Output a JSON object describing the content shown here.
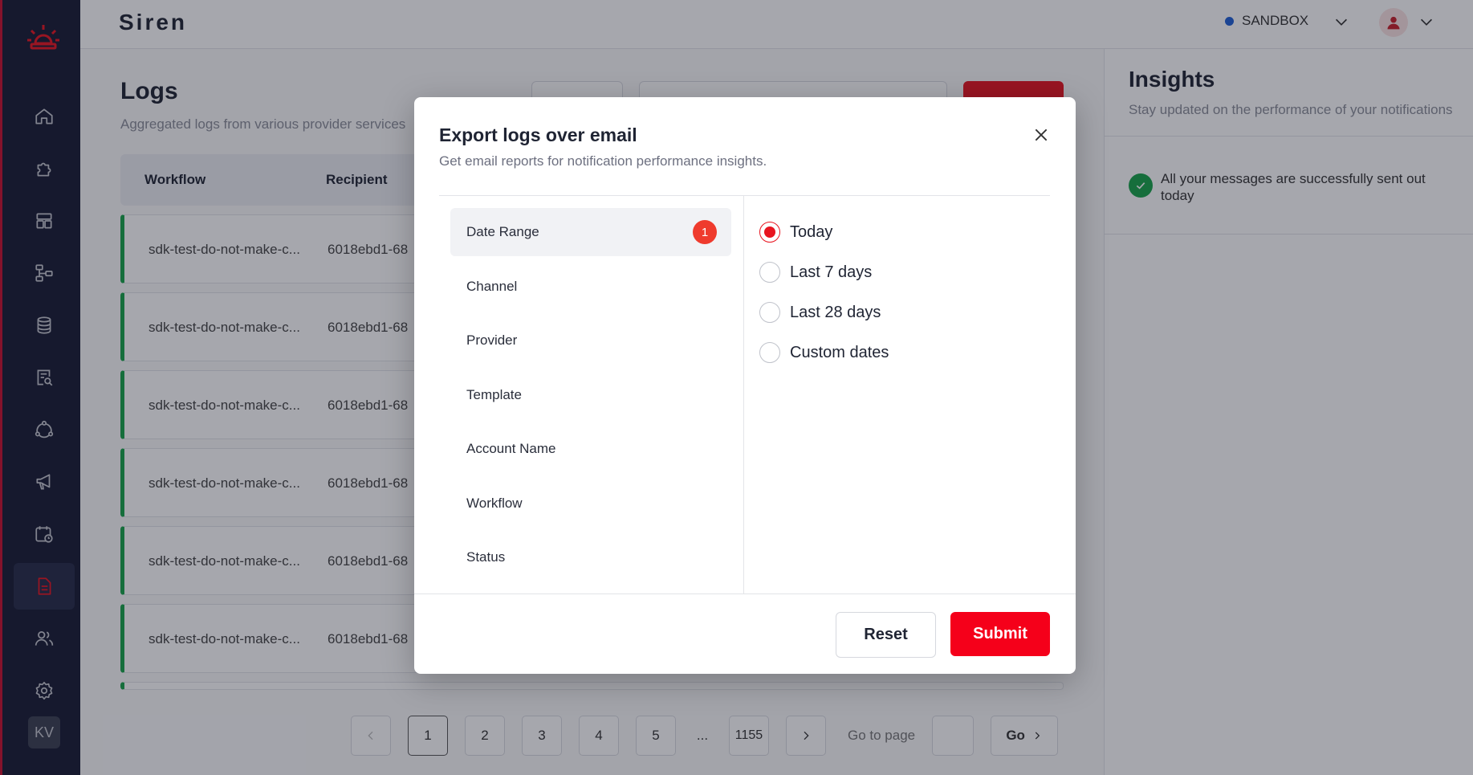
{
  "app": {
    "brand": "Siren",
    "user_initials": "KV"
  },
  "header": {
    "environment": "SANDBOX",
    "env_color": "#1f5fd6"
  },
  "sidebar": {
    "items": [
      {
        "name": "home-icon"
      },
      {
        "name": "puzzle-icon"
      },
      {
        "name": "layout-icon"
      },
      {
        "name": "workflow-icon"
      },
      {
        "name": "database-icon"
      },
      {
        "name": "document-search-icon"
      },
      {
        "name": "network-icon"
      },
      {
        "name": "megaphone-icon"
      },
      {
        "name": "calendar-clock-icon"
      },
      {
        "name": "logs-icon",
        "active": true
      },
      {
        "name": "users-icon"
      },
      {
        "name": "settings-icon"
      }
    ]
  },
  "page": {
    "title": "Logs",
    "subtitle": "Aggregated logs from various provider services",
    "table": {
      "headers": [
        "Workflow",
        "Recipient"
      ],
      "rows": [
        [
          "sdk-test-do-not-make-c...",
          "6018ebd1-68"
        ],
        [
          "sdk-test-do-not-make-c...",
          "6018ebd1-68"
        ],
        [
          "sdk-test-do-not-make-c...",
          "6018ebd1-68"
        ],
        [
          "sdk-test-do-not-make-c...",
          "6018ebd1-68"
        ],
        [
          "sdk-test-do-not-make-c...",
          "6018ebd1-68"
        ],
        [
          "sdk-test-do-not-make-c...",
          "6018ebd1-68"
        ]
      ]
    },
    "pagination": {
      "pages": [
        "1",
        "2",
        "3",
        "4",
        "5"
      ],
      "ellipsis": "...",
      "last": "1155",
      "current": "1",
      "goto_label": "Go to page",
      "go_label": "Go"
    }
  },
  "insights": {
    "title": "Insights",
    "subtitle": "Stay updated on the performance of your notifications",
    "message": "All your messages are successfully sent out today"
  },
  "modal": {
    "title": "Export logs over email",
    "subtitle": "Get email reports for notification performance insights.",
    "categories": [
      {
        "label": "Date Range",
        "badge": "1",
        "active": true
      },
      {
        "label": "Channel"
      },
      {
        "label": "Provider"
      },
      {
        "label": "Template"
      },
      {
        "label": "Account Name"
      },
      {
        "label": "Workflow"
      },
      {
        "label": "Status"
      }
    ],
    "options": [
      {
        "label": "Today",
        "selected": true
      },
      {
        "label": "Last 7 days"
      },
      {
        "label": "Last 28 days"
      },
      {
        "label": "Custom dates"
      }
    ],
    "reset_label": "Reset",
    "submit_label": "Submit"
  },
  "colors": {
    "accent": "#e8141f",
    "success": "#17a34a",
    "sidebar": "#171b33"
  }
}
